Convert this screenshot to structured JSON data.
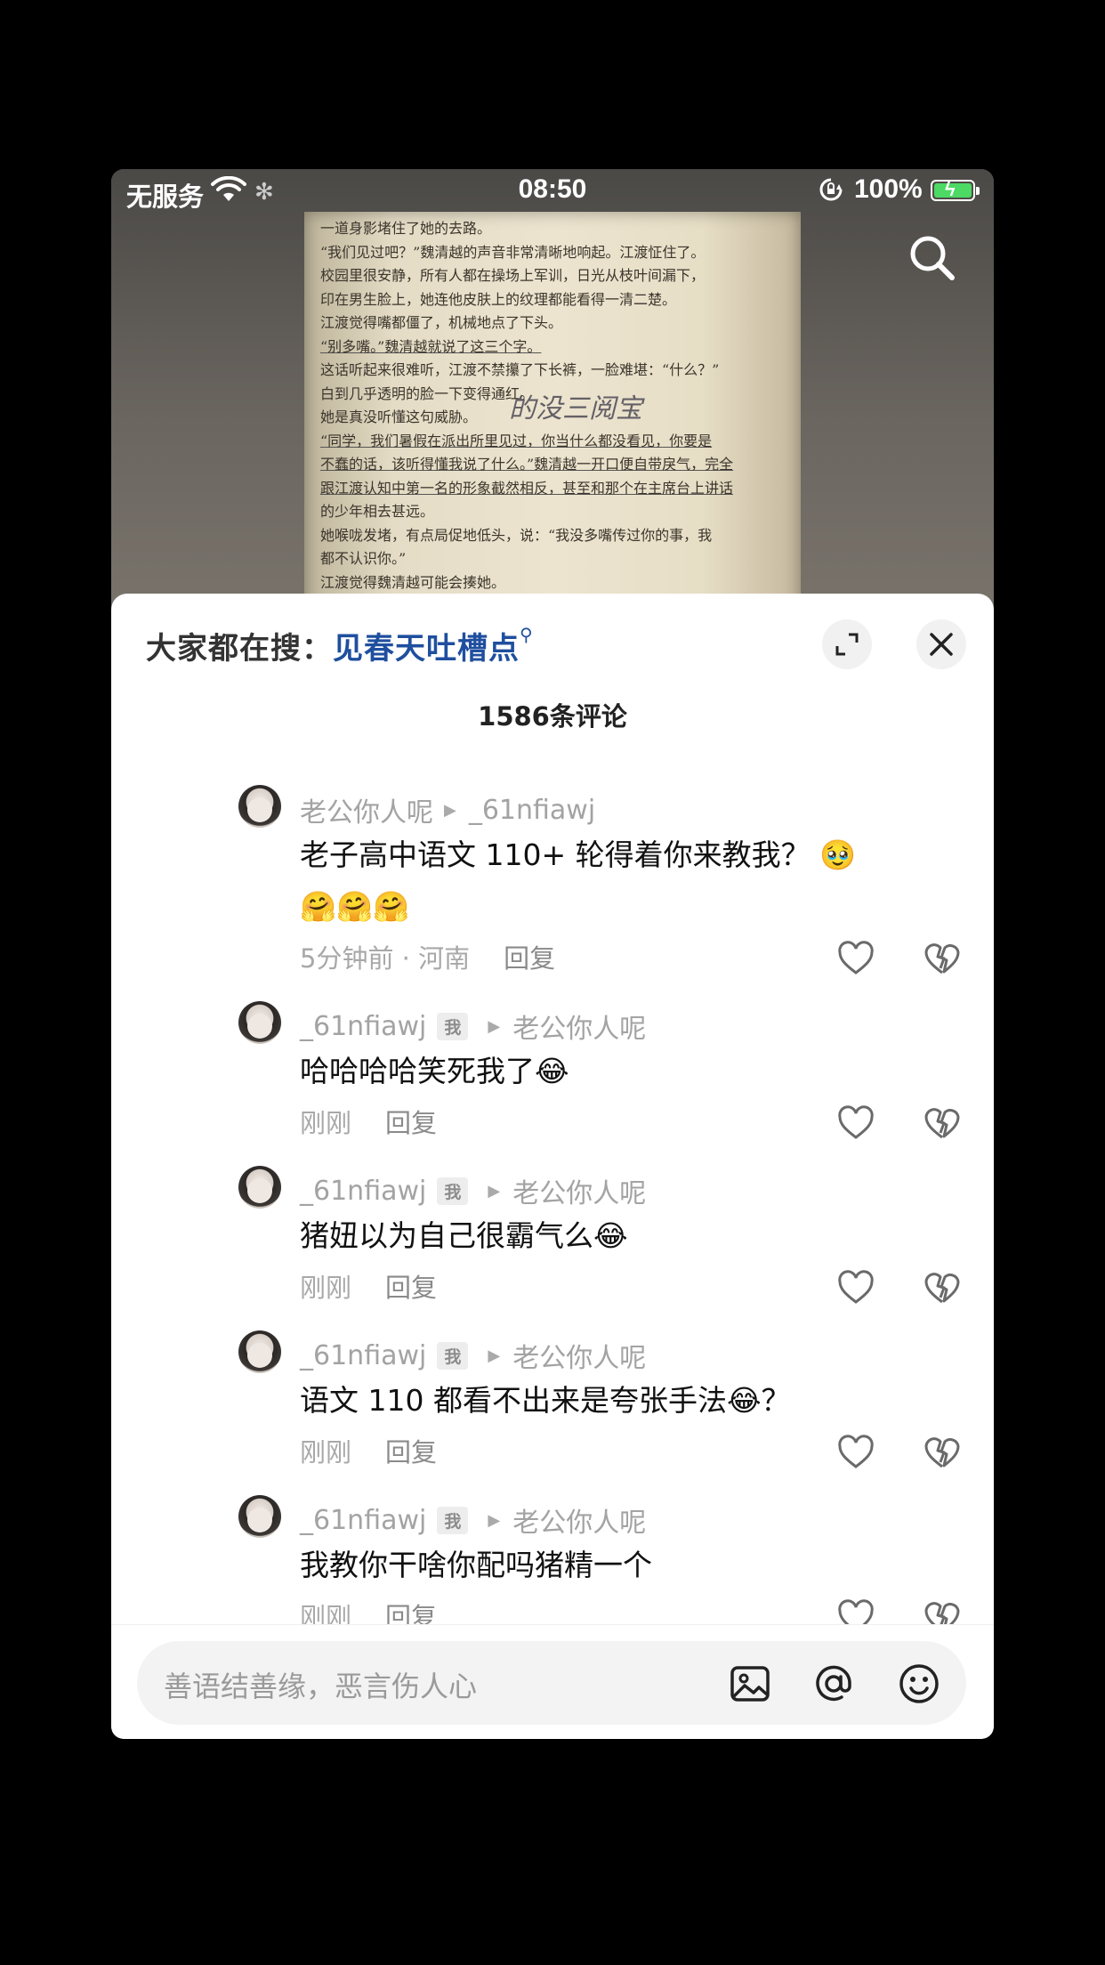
{
  "status_bar": {
    "carrier": "无服务",
    "time": "08:50",
    "battery": "100%"
  },
  "book_page": {
    "lines": [
      "一道身影堵住了她的去路。",
      "“我们见过吧？”魏清越的声音非常清晰地响起。江渡怔住了。",
      "校园里很安静，所有人都在操场上军训，日光从枝叶间漏下，",
      "印在男生脸上，她连他皮肤上的纹理都能看得一清二楚。",
      "江渡觉得嘴都僵了，机械地点了下头。",
      "“别多嘴。”魏清越就说了这三个字。",
      "这话听起来很难听，江渡不禁攥了下长裤，一脸难堪：“什么？”",
      "白到几乎透明的脸一下变得通红。",
      "她是真没听懂这句威胁。",
      "“同学，我们暑假在派出所里见过，你当什么都没看见，你要是",
      "不蠢的话，该听得懂我说了什么。”魏清越一开口便自带戾气，完全",
      "跟江渡认知中第一名的形象截然相反，甚至和那个在主席台上讲话",
      "的少年相去甚远。",
      "她喉咙发堵，有点局促地低头，说：“我没多嘴传过你的事，我",
      "都不认识你。”",
      "江渡觉得魏清越可能会揍她。"
    ],
    "handwriting": "的没三阅宝"
  },
  "sheet": {
    "search_prefix": "大家都在搜：",
    "search_keyword": "见春天吐槽点",
    "comment_count": "1586条评论"
  },
  "comments": [
    {
      "user": "老公你人呢",
      "me": "",
      "reply_to": "_61nfiawj",
      "text": "老子高中语文 110+ 轮得着你来教我？ 🥹🤗🤗🤗",
      "time": "5分钟前 · 河南",
      "reply": "回复"
    },
    {
      "user": "_61nfiawj",
      "me": "我",
      "reply_to": "老公你人呢",
      "text": "哈哈哈哈笑死我了😂",
      "time": "刚刚",
      "reply": "回复"
    },
    {
      "user": "_61nfiawj",
      "me": "我",
      "reply_to": "老公你人呢",
      "text": "猪妞以为自己很霸气么😂",
      "time": "刚刚",
      "reply": "回复"
    },
    {
      "user": "_61nfiawj",
      "me": "我",
      "reply_to": "老公你人呢",
      "text": "语文 110 都看不出来是夸张手法😂？",
      "time": "刚刚",
      "reply": "回复"
    },
    {
      "user": "_61nfiawj",
      "me": "我",
      "reply_to": "老公你人呢",
      "text": "我教你干啥你配吗猪精一个",
      "time": "刚刚",
      "reply": "回复"
    }
  ],
  "input": {
    "placeholder": "善语结善缘，恶言伤人心"
  },
  "colors": {
    "keyword": "#1f4f9e",
    "battery_fill": "#4cd964",
    "muted_text": "#a3a3a3"
  },
  "icons": [
    "wifi-icon",
    "loading-icon",
    "rotation-lock-icon",
    "battery-icon",
    "search-icon",
    "expand-icon",
    "close-icon",
    "heart-icon",
    "broken-heart-icon",
    "image-icon",
    "at-icon",
    "emoji-icon"
  ]
}
